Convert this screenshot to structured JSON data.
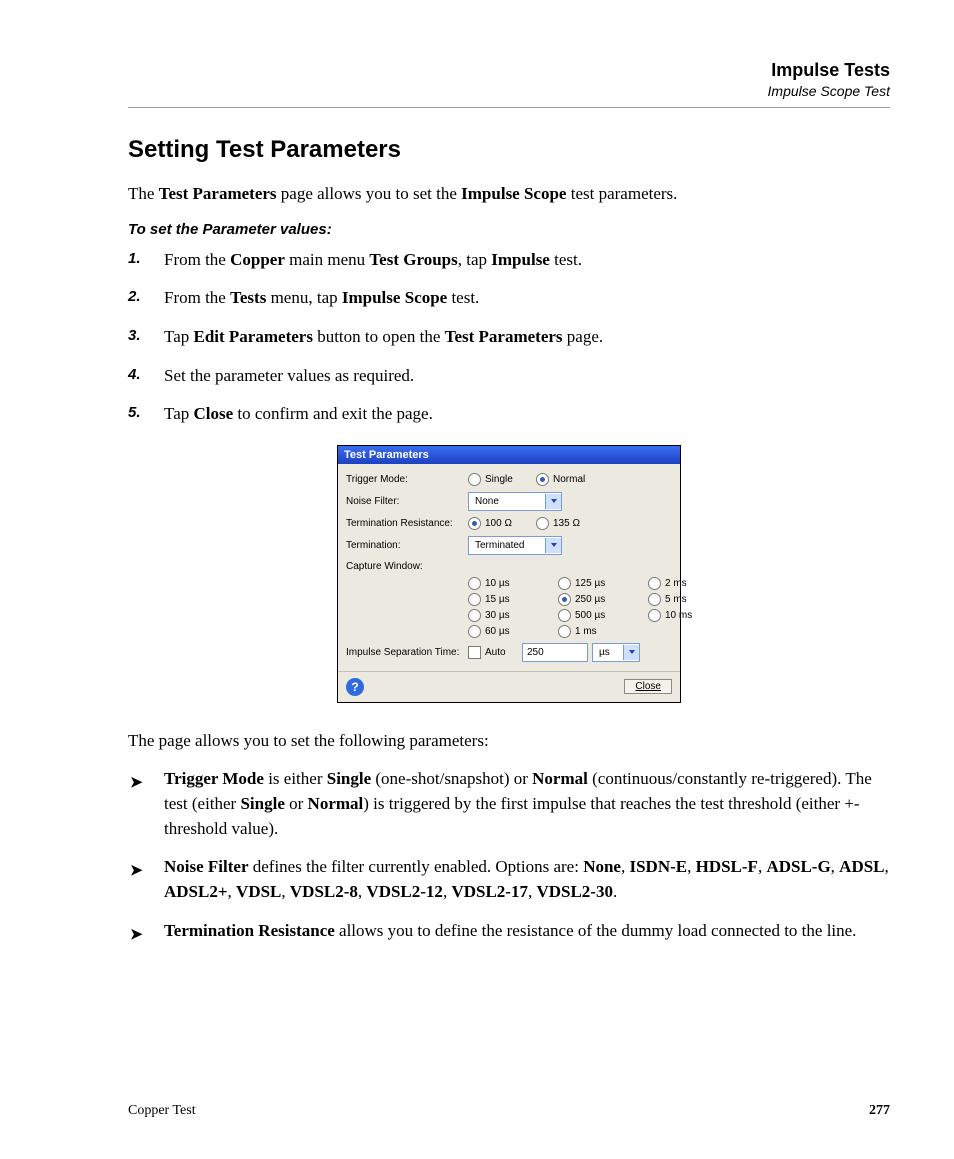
{
  "header": {
    "title": "Impulse Tests",
    "subtitle": "Impulse Scope Test"
  },
  "section": {
    "heading": "Setting Test Parameters"
  },
  "intro": {
    "p1_a": "The ",
    "p1_b": "Test Parameters",
    "p1_c": " page allows you to set the ",
    "p1_d": "Impulse Scope",
    "p1_e": " test parameters."
  },
  "lead": "To set the Parameter values:",
  "steps": [
    {
      "n": "1.",
      "a": "From the ",
      "b": "Copper",
      "c": " main menu ",
      "d": "Test Groups",
      "e": ", tap ",
      "f": "Impulse",
      "g": " test."
    },
    {
      "n": "2.",
      "a": "From the ",
      "b": "Tests",
      "c": " menu, tap ",
      "d": "Impulse Scope",
      "e": " test."
    },
    {
      "n": "3.",
      "a": "Tap ",
      "b": "Edit Parameters",
      "c": " button to open the ",
      "d": "Test Parameters",
      "e": " page."
    },
    {
      "n": "4.",
      "a": "Set the parameter values as required."
    },
    {
      "n": "5.",
      "a": "Tap ",
      "b": "Close",
      "c": " to confirm and exit the page."
    }
  ],
  "dialog": {
    "title": "Test Parameters",
    "trigger": {
      "label": "Trigger Mode:",
      "opts": [
        "Single",
        "Normal"
      ],
      "sel": "Normal"
    },
    "noise": {
      "label": "Noise Filter:",
      "value": "None"
    },
    "termres": {
      "label": "Termination Resistance:",
      "opts": [
        "100 Ω",
        "135 Ω"
      ],
      "sel": "100 Ω"
    },
    "term": {
      "label": "Termination:",
      "value": "Terminated"
    },
    "capture": {
      "label": "Capture Window:",
      "opts": [
        "10 µs",
        "125 µs",
        "2 ms",
        "15 µs",
        "250 µs",
        "5 ms",
        "30 µs",
        "500 µs",
        "10 ms",
        "60 µs",
        "1 ms",
        ""
      ],
      "sel": "250 µs"
    },
    "ist": {
      "label": "Impulse Separation Time:",
      "auto": "Auto",
      "value": "250",
      "unit": "µs"
    },
    "close": "Close",
    "help": "?"
  },
  "after": {
    "para": "The page allows you to set the following parameters:"
  },
  "bullets": [
    {
      "b": "Trigger Mode",
      "t1": " is either ",
      "b2": "Single",
      "t2": " (one-shot/snapshot) or ",
      "b3": "Normal",
      "t3": " (continuous/constantly re-triggered). The test (either ",
      "b4": "Single",
      "t4": " or ",
      "b5": "Normal",
      "t5": ") is triggered by the first impulse that reaches the test threshold (either +- threshold value)."
    },
    {
      "b": "Noise Filter",
      "t1": " defines the filter currently enabled. Options are: ",
      "list": [
        "None",
        "ISDN-E",
        "HDSL-F",
        "ADSL-G",
        "ADSL",
        "ADSL2+",
        "VDSL",
        "VDSL2-8",
        "VDSL2-12",
        "VDSL2-17",
        "VDSL2-30"
      ]
    },
    {
      "b": "Termination Resistance",
      "t1": " allows you to define the resistance of the dummy load connected to the line."
    }
  ],
  "footer": {
    "left": "Copper Test",
    "right": "277"
  }
}
